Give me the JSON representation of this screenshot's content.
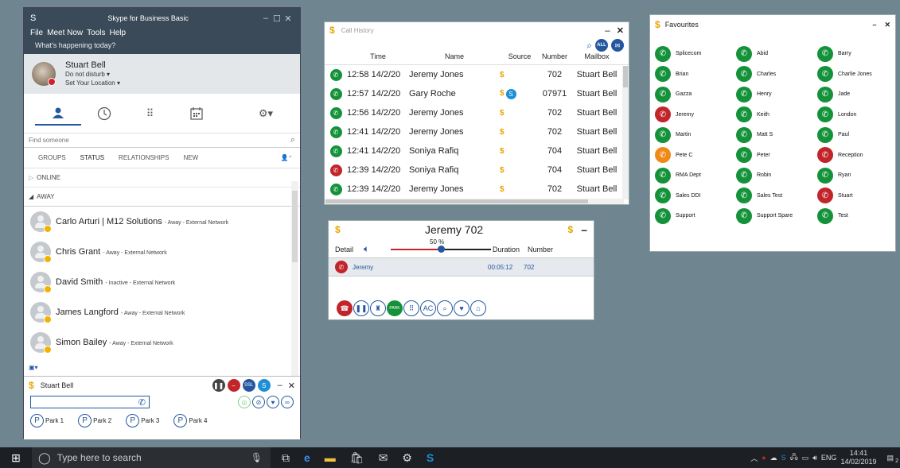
{
  "skype": {
    "title": "Skype for Business Basic",
    "logo": "S",
    "menu": [
      "File",
      "Meet Now",
      "Tools",
      "Help"
    ],
    "happening": "What's happening today?",
    "user": {
      "name": "Stuart Bell",
      "status": "Do not disturb",
      "location": "Set Your Location"
    },
    "search_placeholder": "Find someone",
    "tabs": [
      "GROUPS",
      "STATUS",
      "RELATIONSHIPS",
      "NEW"
    ],
    "groups": {
      "online": "ONLINE",
      "away": "AWAY"
    },
    "contacts": [
      {
        "name": "Carlo Arturi | M12 Solutions",
        "status": "- Away - External Network"
      },
      {
        "name": "Chris Grant",
        "status": "- Away - External Network"
      },
      {
        "name": "David Smith",
        "status": "- Inactive - External Network"
      },
      {
        "name": "James Langford",
        "status": "- Away - External Network"
      },
      {
        "name": "Simon Bailey",
        "status": "- Away - External Network"
      }
    ]
  },
  "minibar": {
    "user": "Stuart Bell",
    "parks": [
      "Park 1",
      "Park 2",
      "Park 3",
      "Park 4"
    ]
  },
  "history": {
    "title": "Call History",
    "columns": [
      "Time",
      "Name",
      "Source",
      "Number",
      "Mailbox"
    ],
    "filter_label": "ALL",
    "rows": [
      {
        "status": "green",
        "time": "12:58 14/2/20",
        "name": "Jeremy Jones",
        "number": "702",
        "mailbox": "Stuart Bell",
        "skype": false
      },
      {
        "status": "green",
        "time": "12:57 14/2/20",
        "name": "Gary Roche",
        "number": "07971",
        "mailbox": "Stuart Bell",
        "skype": true
      },
      {
        "status": "green",
        "time": "12:56 14/2/20",
        "name": "Jeremy Jones",
        "number": "702",
        "mailbox": "Stuart Bell",
        "skype": false
      },
      {
        "status": "green",
        "time": "12:41 14/2/20",
        "name": "Jeremy Jones",
        "number": "702",
        "mailbox": "Stuart Bell",
        "skype": false
      },
      {
        "status": "green",
        "time": "12:41 14/2/20",
        "name": "Soniya Rafiq",
        "number": "704",
        "mailbox": "Stuart Bell",
        "skype": false
      },
      {
        "status": "red",
        "time": "12:39 14/2/20",
        "name": "Soniya Rafiq",
        "number": "704",
        "mailbox": "Stuart Bell",
        "skype": false
      },
      {
        "status": "green",
        "time": "12:39 14/2/20",
        "name": "Jeremy Jones",
        "number": "702",
        "mailbox": "Stuart Bell",
        "skype": false
      }
    ]
  },
  "callwin": {
    "title": "Jeremy 702",
    "detail_label": "Detail",
    "volume": "50 %",
    "volume_fraction": 0.5,
    "duration_label": "Duration",
    "number_label": "Number",
    "call": {
      "name": "Jeremy",
      "duration": "00:05:12",
      "number": "702"
    },
    "controls": [
      {
        "icon": "hangup-icon",
        "glyph": "☎",
        "color": "#c12429"
      },
      {
        "icon": "hold-icon",
        "glyph": "❚❚",
        "color": ""
      },
      {
        "icon": "transfer-icon",
        "glyph": "♜",
        "color": ""
      },
      {
        "icon": "park-icon",
        "glyph": "PARK",
        "color": "#14923a"
      },
      {
        "icon": "keypad-icon",
        "glyph": "⠿",
        "color": ""
      },
      {
        "icon": "ac-icon",
        "glyph": "AC",
        "color": ""
      },
      {
        "icon": "search-icon",
        "glyph": "⌕",
        "color": ""
      },
      {
        "icon": "heart-icon",
        "glyph": "♥",
        "color": ""
      },
      {
        "icon": "home-icon",
        "glyph": "⌂",
        "color": ""
      }
    ]
  },
  "favourites": {
    "title": "Favourites",
    "items": [
      {
        "name": "Splicecom",
        "status": "green"
      },
      {
        "name": "Abid",
        "status": "green"
      },
      {
        "name": "Barry",
        "status": "green"
      },
      {
        "name": "Brian",
        "status": "green"
      },
      {
        "name": "Charles",
        "status": "green"
      },
      {
        "name": "Charlie Jones",
        "status": "green"
      },
      {
        "name": "Gazza",
        "status": "green"
      },
      {
        "name": "Henry",
        "status": "green"
      },
      {
        "name": "Jade",
        "status": "green"
      },
      {
        "name": "Jeremy",
        "status": "red"
      },
      {
        "name": "Keith",
        "status": "green"
      },
      {
        "name": "London",
        "status": "green"
      },
      {
        "name": "Martin",
        "status": "green"
      },
      {
        "name": "Matt S",
        "status": "green"
      },
      {
        "name": "Paul",
        "status": "green"
      },
      {
        "name": "Pete C",
        "status": "orange"
      },
      {
        "name": "Peter",
        "status": "green"
      },
      {
        "name": "Reception",
        "status": "red"
      },
      {
        "name": "RMA Dept",
        "status": "green"
      },
      {
        "name": "Robin",
        "status": "green"
      },
      {
        "name": "Ryan",
        "status": "green"
      },
      {
        "name": "Sales DDI",
        "status": "green"
      },
      {
        "name": "Sales Test",
        "status": "green"
      },
      {
        "name": "Stuart",
        "status": "red"
      },
      {
        "name": "Support",
        "status": "green"
      },
      {
        "name": "Support Spare",
        "status": "green"
      },
      {
        "name": "Test",
        "status": "green"
      }
    ]
  },
  "taskbar": {
    "search_placeholder": "Type here to search",
    "lang": "ENG",
    "time": "14:41",
    "date": "14/02/2019",
    "notifications": "2"
  },
  "colors": {
    "green": "#14923a",
    "red": "#c12429",
    "orange": "#f08a16",
    "accent": "#2457a0",
    "skype_title": "#3b4a58"
  }
}
